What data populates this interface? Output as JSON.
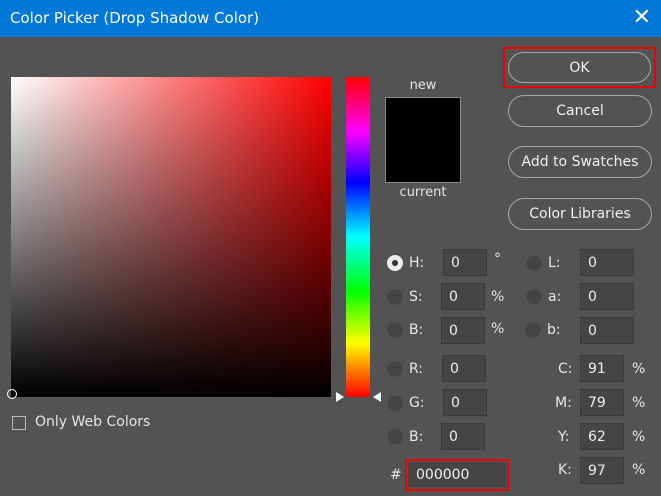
{
  "title": "Color Picker (Drop Shadow Color)",
  "buttons": {
    "ok": "OK",
    "cancel": "Cancel",
    "add_to_swatches": "Add to Swatches",
    "color_libraries": "Color Libraries"
  },
  "swatch": {
    "new_label": "new",
    "current_label": "current",
    "new_color": "#000000",
    "current_color": "#000000"
  },
  "only_web_colors": "Only Web Colors",
  "fields": {
    "H": {
      "label": "H:",
      "value": "0",
      "unit": "°"
    },
    "S": {
      "label": "S:",
      "value": "0",
      "unit": "%"
    },
    "Bv": {
      "label": "B:",
      "value": "0",
      "unit": "%"
    },
    "R": {
      "label": "R:",
      "value": "0"
    },
    "G": {
      "label": "G:",
      "value": "0"
    },
    "B": {
      "label": "B:",
      "value": "0"
    },
    "L": {
      "label": "L:",
      "value": "0"
    },
    "a": {
      "label": "a:",
      "value": "0"
    },
    "b": {
      "label": "b:",
      "value": "0"
    },
    "C": {
      "label": "C:",
      "value": "91",
      "unit": "%"
    },
    "M": {
      "label": "M:",
      "value": "79",
      "unit": "%"
    },
    "Y": {
      "label": "Y:",
      "value": "62",
      "unit": "%"
    },
    "K": {
      "label": "K:",
      "value": "97",
      "unit": "%"
    }
  },
  "hex": {
    "label": "#",
    "value": "000000"
  },
  "hue_degrees": 0
}
